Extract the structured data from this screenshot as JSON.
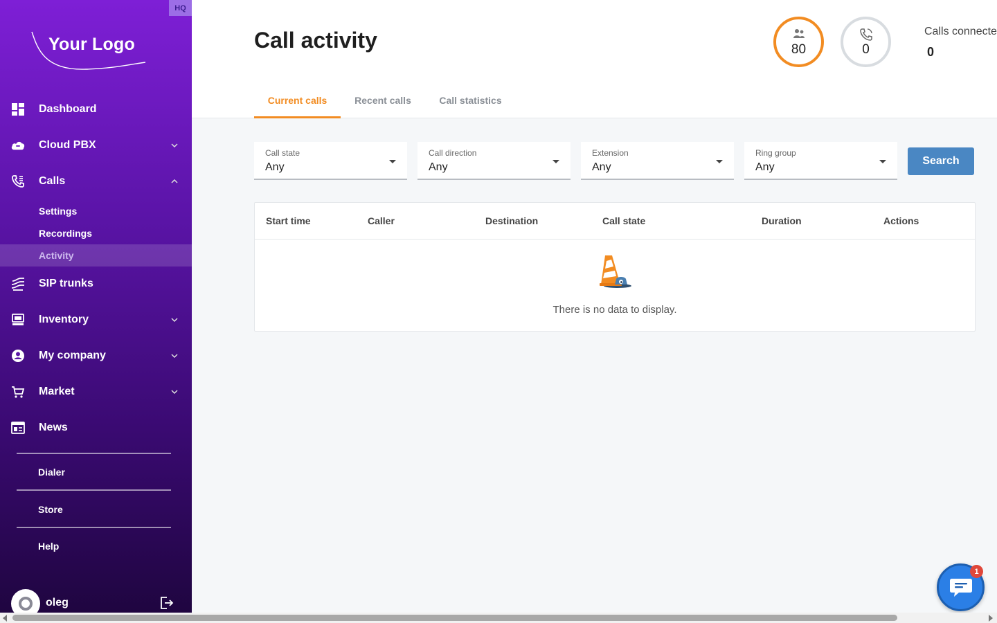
{
  "sidebar": {
    "badge": "HQ",
    "logo_text": "Your Logo",
    "nav": [
      {
        "label": "Dashboard",
        "icon": "dashboard-icon"
      },
      {
        "label": "Cloud PBX",
        "icon": "cloud-icon"
      },
      {
        "label": "Calls",
        "icon": "phone-icon"
      },
      {
        "label": "SIP trunks",
        "icon": "sip-trunks-icon"
      },
      {
        "label": "Inventory",
        "icon": "inventory-icon"
      },
      {
        "label": "My company",
        "icon": "company-icon"
      },
      {
        "label": "Market",
        "icon": "cart-icon"
      },
      {
        "label": "News",
        "icon": "news-icon"
      }
    ],
    "calls_sub": [
      {
        "label": "Settings"
      },
      {
        "label": "Recordings"
      },
      {
        "label": "Activity"
      }
    ],
    "bottom_links": [
      {
        "label": "Dialer"
      },
      {
        "label": "Store"
      },
      {
        "label": "Help"
      }
    ],
    "user": {
      "name": "oleg"
    },
    "colors": {
      "gradient_top": "#7e1fd6",
      "gradient_bottom": "#1f0540"
    }
  },
  "header": {
    "title": "Call activity",
    "stats": {
      "users_value": "80",
      "calls_value": "0",
      "calls_connected_label": "Calls connecte",
      "calls_connected_value": "0"
    },
    "tabs": [
      {
        "label": "Current calls",
        "active": true
      },
      {
        "label": "Recent calls",
        "active": false
      },
      {
        "label": "Call statistics",
        "active": false
      }
    ]
  },
  "filters": [
    {
      "label": "Call state",
      "value": "Any"
    },
    {
      "label": "Call direction",
      "value": "Any"
    },
    {
      "label": "Extension",
      "value": "Any"
    },
    {
      "label": "Ring group",
      "value": "Any"
    }
  ],
  "search_label": "Search",
  "table": {
    "columns": [
      "Start time",
      "Caller",
      "Destination",
      "Call state",
      "Duration",
      "Actions"
    ],
    "empty_message": "There is no data to display."
  },
  "chat": {
    "badge_count": "1"
  },
  "colors": {
    "accent": "#f28c22",
    "button": "#4a87c3",
    "chat": "#2b7fe6",
    "badge": "#e0473a"
  }
}
